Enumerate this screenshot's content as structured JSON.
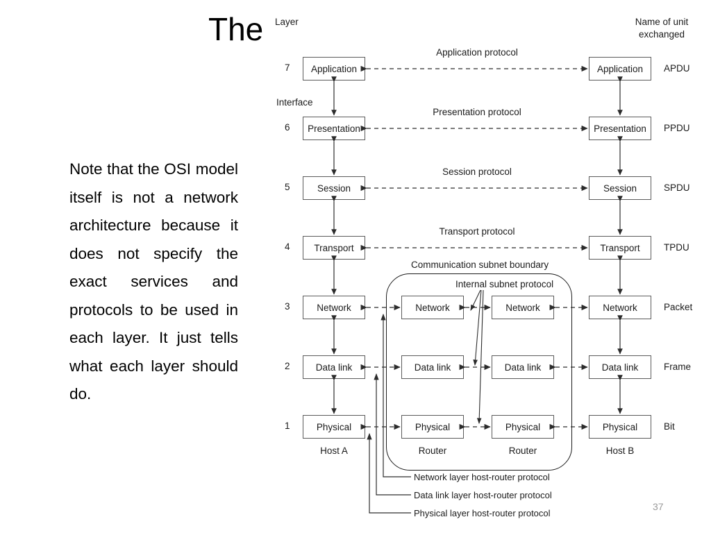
{
  "slide": {
    "title": "The",
    "body_text": "Note that the OSI model itself is not a network architecture because it does not specify the exact services and protocols to be used in each layer. It just tells what each layer should do.",
    "page_number": "37"
  },
  "figure": {
    "layer_header": "Layer",
    "unit_header_line1": "Name of unit",
    "unit_header_line2": "exchanged",
    "interface_label": "Interface",
    "subnet_boundary_label": "Communication subnet boundary",
    "internal_subnet_label": "Internal subnet protocol",
    "hosts": {
      "host_a": "Host A",
      "host_b": "Host B",
      "router_left": "Router",
      "router_right": "Router"
    },
    "layers": [
      {
        "number": "7",
        "name": "Application",
        "protocol": "Application protocol",
        "unit": "APDU"
      },
      {
        "number": "6",
        "name": "Presentation",
        "protocol": "Presentation protocol",
        "unit": "PPDU"
      },
      {
        "number": "5",
        "name": "Session",
        "protocol": "Session protocol",
        "unit": "SPDU"
      },
      {
        "number": "4",
        "name": "Transport",
        "protocol": "Transport protocol",
        "unit": "TPDU"
      },
      {
        "number": "3",
        "name": "Network",
        "protocol": "",
        "unit": "Packet"
      },
      {
        "number": "2",
        "name": "Data link",
        "protocol": "",
        "unit": "Frame"
      },
      {
        "number": "1",
        "name": "Physical",
        "protocol": "",
        "unit": "Bit"
      }
    ],
    "router_layers": [
      {
        "name": "Network"
      },
      {
        "name": "Data link"
      },
      {
        "name": "Physical"
      }
    ],
    "host_router_protocols": [
      "Network layer host-router protocol",
      "Data link layer host-router protocol",
      "Physical layer host-router protocol"
    ]
  },
  "colors": {
    "box_border": "#5a5a5a",
    "line": "#2c2c2c",
    "boundary": "#1c1c1c",
    "text": "#1a1a1a",
    "page_number": "#9a9a9a"
  }
}
